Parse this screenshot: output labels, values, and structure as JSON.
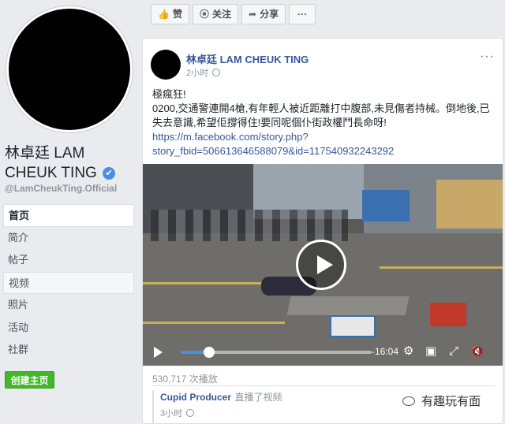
{
  "page": {
    "name": "林卓廷 LAM CHEUK TING",
    "handle": "@LamCheukTing.Official",
    "verified": "✔"
  },
  "nav": {
    "items": [
      {
        "label": "首页"
      },
      {
        "label": "简介"
      },
      {
        "label": "帖子"
      },
      {
        "label": "视频"
      },
      {
        "label": "照片"
      },
      {
        "label": "活动"
      },
      {
        "label": "社群"
      }
    ],
    "create_label": "创建主页"
  },
  "actions": {
    "like": "赞",
    "follow": "关注",
    "share": "分享",
    "more": "···"
  },
  "post": {
    "author": "林卓廷 LAM CHEUK TING",
    "time": "2小时",
    "menu": "···",
    "line1": "極瘋狂!",
    "line2": "0200,交通警連開4槍,有年輕人被近距離打中腹部,未見傷者持械。倒地後,已失去意識,希望佢撐得住!要同呢個仆街政權鬥長命呀!",
    "link": "https://m.facebook.com/story.php?story_fbid=506613646588079&id=117540932243292"
  },
  "video": {
    "time_left": "-16:04",
    "progress": 0.15,
    "settings_icon": "⚙",
    "pip_icon": "▣",
    "fullscreen_icon": "⤢",
    "mute_icon": "🔇"
  },
  "views": "530,717 次播放",
  "shared": {
    "by": "Cupid Producer",
    "action": "直播了视频",
    "time": "3小时"
  },
  "watermark": "有趣玩有面"
}
